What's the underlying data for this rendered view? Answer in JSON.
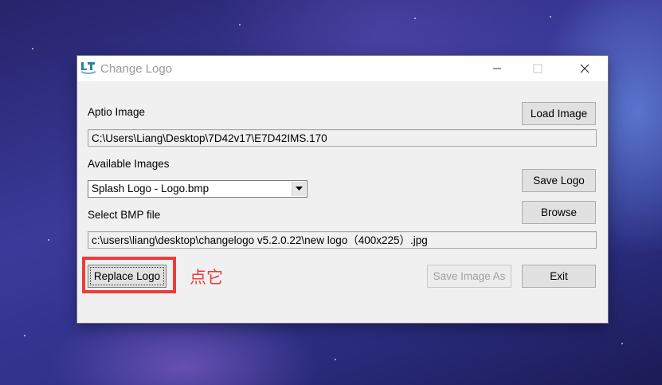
{
  "window": {
    "title": "Change Logo",
    "controls": [
      "minimize-icon",
      "maximize-icon",
      "close-icon"
    ]
  },
  "aptio": {
    "label": "Aptio Image",
    "path": "C:\\Users\\Liang\\Desktop\\7D42v17\\E7D42IMS.170",
    "load_button": "Load Image"
  },
  "images": {
    "label": "Available Images",
    "selected": "Splash Logo - Logo.bmp",
    "save_button": "Save Logo"
  },
  "bmp": {
    "label": "Select BMP file",
    "path": "c:\\users\\liang\\desktop\\changelogo v5.2.0.22\\new logo（400x225）.jpg",
    "browse_button": "Browse"
  },
  "actions": {
    "replace_button": "Replace Logo",
    "save_as_button": "Save Image As",
    "exit_button": "Exit"
  },
  "annotation": {
    "text": "点它",
    "color": "#ef3b3b"
  }
}
